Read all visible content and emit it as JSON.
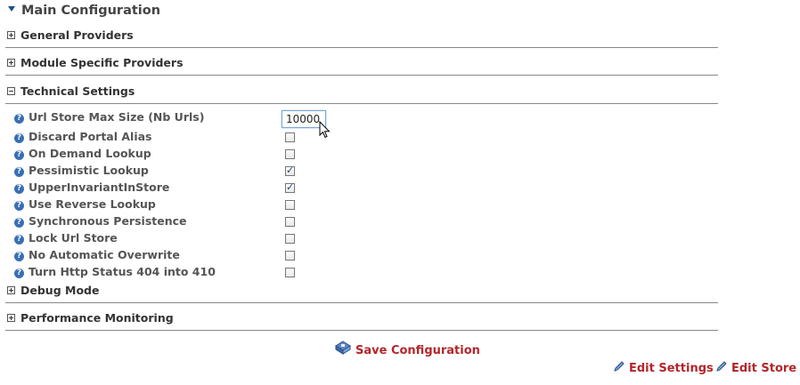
{
  "main_title": "Main Configuration",
  "sections": {
    "general": "General Providers",
    "module": "Module Specific Providers",
    "technical": "Technical Settings",
    "debug": "Debug Mode",
    "performance": "Performance Monitoring"
  },
  "settings": {
    "url_store_max_size": {
      "label": "Url Store Max Size (Nb Urls)",
      "value": "10000"
    },
    "discard_portal_alias": {
      "label": "Discard Portal Alias",
      "checked": false
    },
    "on_demand_lookup": {
      "label": "On Demand Lookup",
      "checked": false
    },
    "pessimistic_lookup": {
      "label": "Pessimistic Lookup",
      "checked": true
    },
    "upper_invariant": {
      "label": "UpperInvariantInStore",
      "checked": true
    },
    "reverse_lookup": {
      "label": "Use Reverse Lookup",
      "checked": false
    },
    "sync_persistence": {
      "label": "Synchronous Persistence",
      "checked": false
    },
    "lock_url_store": {
      "label": "Lock Url Store",
      "checked": false
    },
    "no_auto_overwrite": {
      "label": "No Automatic Overwrite",
      "checked": false
    },
    "http_404_410": {
      "label": "Turn Http Status 404 into 410",
      "checked": false
    }
  },
  "help_glyph": "?",
  "check_glyph": "✓",
  "actions": {
    "save": "Save Configuration",
    "edit_settings": "Edit Settings",
    "edit_store": "Edit Store"
  }
}
